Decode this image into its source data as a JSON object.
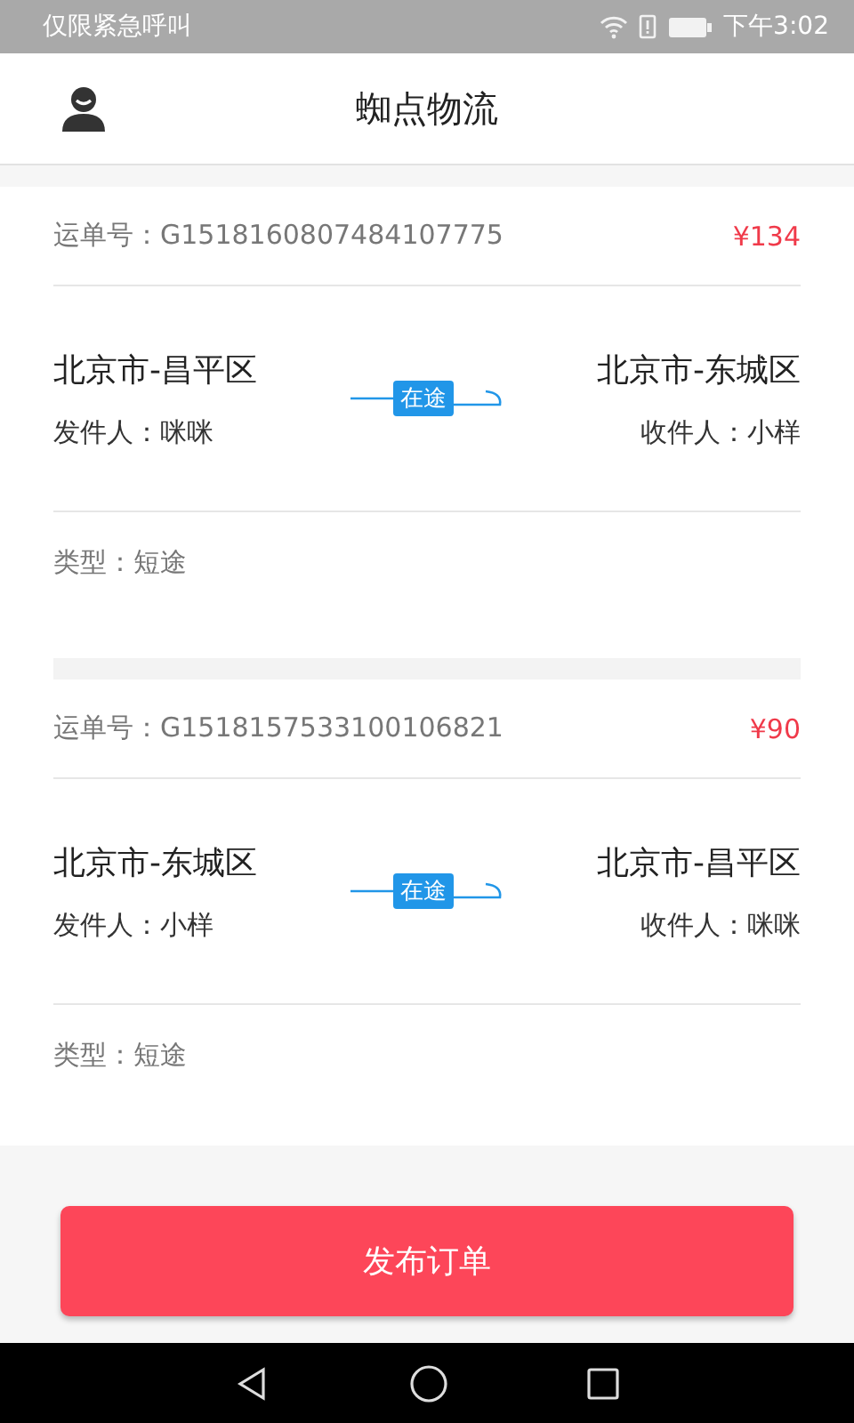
{
  "status_bar": {
    "carrier": "仅限紧急呼叫",
    "time": "下午3:02"
  },
  "header": {
    "title": "蜘点物流"
  },
  "orders": [
    {
      "waybill": "运单号：G1518160807484107775",
      "price": "¥134",
      "from": "北京市-昌平区",
      "to": "北京市-东城区",
      "sender": "发件人：咪咪",
      "receiver": "收件人：小样",
      "status": "在途",
      "type": "类型：短途"
    },
    {
      "waybill": "运单号：G1518157533100106821",
      "price": "¥90",
      "from": "北京市-东城区",
      "to": "北京市-昌平区",
      "sender": "发件人：小样",
      "receiver": "收件人：咪咪",
      "status": "在途",
      "type": "类型：短途"
    }
  ],
  "publish_button": "发布订单"
}
